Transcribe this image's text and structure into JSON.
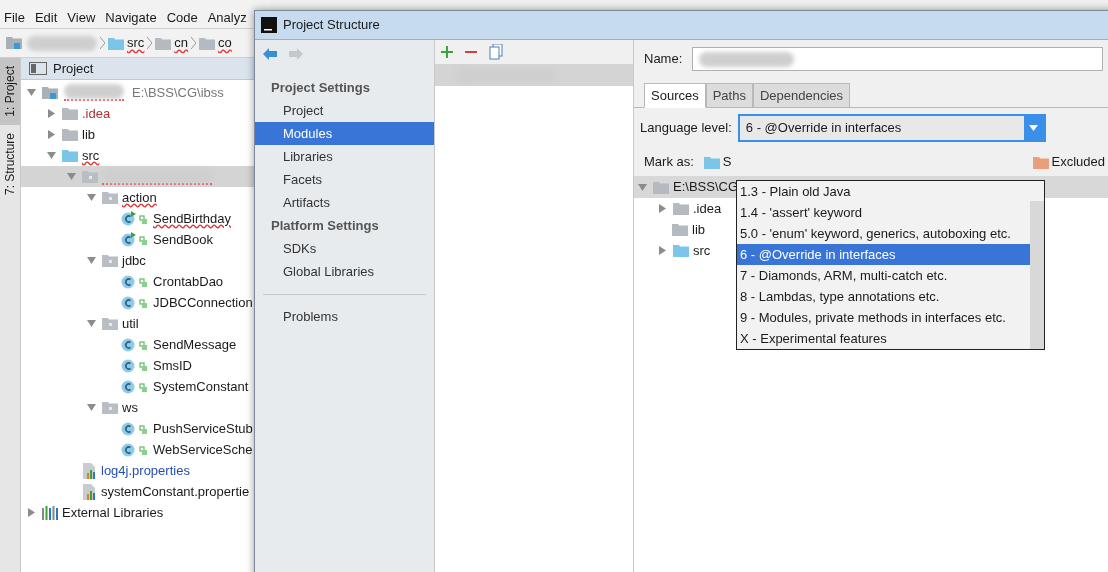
{
  "menu": [
    "File",
    "Edit",
    "View",
    "Navigate",
    "Code",
    "Analyz"
  ],
  "breadcrumb": [
    {
      "label": "src",
      "misspelled": true
    },
    {
      "label": "cn",
      "misspelled": true
    },
    {
      "label": "co",
      "misspelled": true
    }
  ],
  "tool_strip": [
    {
      "label": "1: Project",
      "selected": true
    },
    {
      "label": "7: Structure",
      "selected": false
    }
  ],
  "project_panel": {
    "title": "Project",
    "tree": [
      {
        "kind": "module",
        "path": "E:\\BSS\\CG\\ibss",
        "expanded": true,
        "misspelled": true,
        "selected": false,
        "children": [
          {
            "kind": "folder",
            "label": ".idea",
            "color": "#b03030",
            "expanded": false,
            "misspelled": false,
            "selected": false
          },
          {
            "kind": "folder",
            "label": "lib",
            "expanded": false,
            "misspelled": false,
            "selected": false
          },
          {
            "kind": "source",
            "label": "src",
            "expanded": true,
            "misspelled": true,
            "selected": false,
            "children": [
              {
                "kind": "package",
                "expanded": true,
                "misspelled": true,
                "selected": true,
                "children": [
                  {
                    "kind": "package",
                    "label": "action",
                    "expanded": true,
                    "misspelled": true,
                    "selected": false,
                    "children": [
                      {
                        "kind": "runnable",
                        "label": "SendBirthday",
                        "misspelled": true,
                        "selected": false
                      },
                      {
                        "kind": "runnable",
                        "label": "SendBook",
                        "misspelled": false,
                        "selected": false
                      }
                    ]
                  },
                  {
                    "kind": "package",
                    "label": "jdbc",
                    "expanded": true,
                    "misspelled": false,
                    "selected": false,
                    "children": [
                      {
                        "kind": "class",
                        "label": "CrontabDao",
                        "misspelled": false,
                        "selected": false
                      },
                      {
                        "kind": "class",
                        "label": "JDBCConnection",
                        "misspelled": false,
                        "selected": false
                      }
                    ]
                  },
                  {
                    "kind": "package",
                    "label": "util",
                    "expanded": true,
                    "misspelled": false,
                    "selected": false,
                    "children": [
                      {
                        "kind": "class",
                        "label": "SendMessage",
                        "misspelled": false,
                        "selected": false
                      },
                      {
                        "kind": "class",
                        "label": "SmsID",
                        "misspelled": false,
                        "selected": false
                      },
                      {
                        "kind": "class",
                        "label": "SystemConstant",
                        "misspelled": false,
                        "selected": false
                      }
                    ]
                  },
                  {
                    "kind": "package",
                    "label": "ws",
                    "expanded": true,
                    "misspelled": false,
                    "selected": false,
                    "children": [
                      {
                        "kind": "class",
                        "label": "PushServiceStub",
                        "misspelled": false,
                        "selected": false
                      },
                      {
                        "kind": "class",
                        "label": "WebServiceSche",
                        "misspelled": false,
                        "selected": false
                      }
                    ]
                  }
                ]
              },
              {
                "kind": "properties",
                "label": "log4j.properties",
                "color": "#2550b0",
                "misspelled": false,
                "selected": false
              },
              {
                "kind": "properties",
                "label": "systemConstant.propertie",
                "misspelled": false,
                "selected": false
              }
            ]
          }
        ]
      },
      {
        "kind": "library",
        "label": "External Libraries",
        "expanded": false,
        "misspelled": false,
        "selected": false
      }
    ]
  },
  "dialog": {
    "title": "Project Structure",
    "nav": [
      {
        "kind": "header",
        "label": "Project Settings"
      },
      {
        "kind": "item",
        "label": "Project",
        "selected": false
      },
      {
        "kind": "item",
        "label": "Modules",
        "selected": true
      },
      {
        "kind": "item",
        "label": "Libraries",
        "selected": false
      },
      {
        "kind": "item",
        "label": "Facets",
        "selected": false
      },
      {
        "kind": "item",
        "label": "Artifacts",
        "selected": false
      },
      {
        "kind": "header",
        "label": "Platform Settings"
      },
      {
        "kind": "item",
        "label": "SDKs",
        "selected": false
      },
      {
        "kind": "item",
        "label": "Global Libraries",
        "selected": false
      },
      {
        "kind": "separator"
      },
      {
        "kind": "item",
        "label": "Problems",
        "selected": false
      }
    ],
    "name_label": "Name:",
    "tabs": [
      {
        "label": "Sources",
        "selected": true
      },
      {
        "label": "Paths",
        "selected": false
      },
      {
        "label": "Dependencies",
        "selected": false
      }
    ],
    "language_level": {
      "label": "Language level:",
      "value": "6 - @Override in interfaces",
      "options": [
        {
          "label": "1.3 - Plain old Java",
          "selected": false
        },
        {
          "label": "1.4 - 'assert' keyword",
          "selected": false
        },
        {
          "label": "5.0 - 'enum' keyword, generics, autoboxing etc.",
          "selected": false
        },
        {
          "label": "6 - @Override in interfaces",
          "selected": true
        },
        {
          "label": "7 - Diamonds, ARM, multi-catch etc.",
          "selected": false
        },
        {
          "label": "8 - Lambdas, type annotations etc.",
          "selected": false
        },
        {
          "label": "9 - Modules, private methods in interfaces etc.",
          "selected": false
        },
        {
          "label": "X - Experimental features",
          "selected": false
        }
      ]
    },
    "mark_as": {
      "label": "Mark as:",
      "items": [
        {
          "kind": "sources",
          "label": "S"
        },
        {
          "kind": "excluded",
          "label": "Excluded"
        }
      ]
    },
    "content_root": {
      "path": "E:\\BSS\\CG",
      "children": [
        {
          "kind": "folder",
          "label": ".idea",
          "expanded": false
        },
        {
          "kind": "folder",
          "label": "lib"
        },
        {
          "kind": "source",
          "label": "src",
          "expanded": false
        }
      ]
    }
  }
}
